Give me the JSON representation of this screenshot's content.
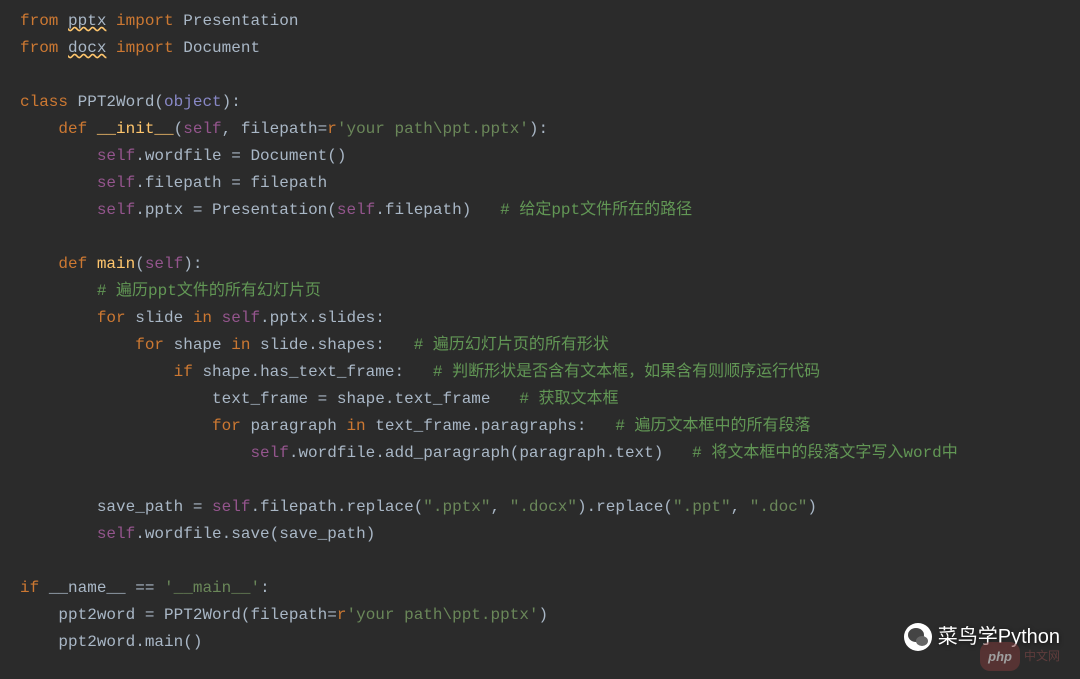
{
  "code_lines": [
    {
      "raw": "from pptx import Presentation",
      "tokens": [
        [
          "kw",
          "from "
        ],
        [
          "warn",
          "pptx"
        ],
        [
          "kw",
          " import "
        ],
        [
          "ident",
          "Presentation"
        ]
      ]
    },
    {
      "raw": "from docx import Document",
      "tokens": [
        [
          "kw",
          "from "
        ],
        [
          "warn",
          "docx"
        ],
        [
          "kw",
          " import "
        ],
        [
          "ident",
          "Document"
        ]
      ]
    },
    {
      "raw": ""
    },
    {
      "raw": "class PPT2Word(object):",
      "tokens": [
        [
          "kw",
          "class "
        ],
        [
          "ident",
          "PPT2Word"
        ],
        [
          "par",
          "("
        ],
        [
          "builtin",
          "object"
        ],
        [
          "par",
          ")"
        ],
        [
          "op",
          ":"
        ]
      ]
    },
    {
      "raw": "    def __init__(self, filepath=r'your path\\ppt.pptx'):",
      "tokens": [
        [
          "ident",
          "    "
        ],
        [
          "kw",
          "def "
        ],
        [
          "fn",
          "__init__"
        ],
        [
          "par",
          "("
        ],
        [
          "selfc",
          "self"
        ],
        [
          "op",
          ", "
        ],
        [
          "ident",
          "filepath"
        ],
        [
          "op",
          "="
        ],
        [
          "kw",
          "r"
        ],
        [
          "str",
          "'your path\\ppt.pptx'"
        ],
        [
          "par",
          ")"
        ],
        [
          "op",
          ":"
        ]
      ]
    },
    {
      "raw": "        self.wordfile = Document()",
      "tokens": [
        [
          "ident",
          "        "
        ],
        [
          "selfc",
          "self"
        ],
        [
          "op",
          "."
        ],
        [
          "ident",
          "wordfile "
        ],
        [
          "op",
          "= "
        ],
        [
          "ident",
          "Document"
        ],
        [
          "par",
          "()"
        ]
      ]
    },
    {
      "raw": "        self.filepath = filepath",
      "tokens": [
        [
          "ident",
          "        "
        ],
        [
          "selfc",
          "self"
        ],
        [
          "op",
          "."
        ],
        [
          "ident",
          "filepath "
        ],
        [
          "op",
          "= "
        ],
        [
          "ident",
          "filepath"
        ]
      ]
    },
    {
      "raw": "        self.pptx = Presentation(self.filepath)   # 给定ppt文件所在的路径",
      "tokens": [
        [
          "ident",
          "        "
        ],
        [
          "selfc",
          "self"
        ],
        [
          "op",
          "."
        ],
        [
          "ident",
          "pptx "
        ],
        [
          "op",
          "= "
        ],
        [
          "ident",
          "Presentation"
        ],
        [
          "par",
          "("
        ],
        [
          "selfc",
          "self"
        ],
        [
          "op",
          "."
        ],
        [
          "ident",
          "filepath"
        ],
        [
          "par",
          ")"
        ],
        [
          "ident",
          "   "
        ],
        [
          "cmtg",
          "# 给定ppt文件所在的路径"
        ]
      ]
    },
    {
      "raw": ""
    },
    {
      "raw": "    def main(self):",
      "tokens": [
        [
          "ident",
          "    "
        ],
        [
          "kw",
          "def "
        ],
        [
          "fn",
          "main"
        ],
        [
          "par",
          "("
        ],
        [
          "selfc",
          "self"
        ],
        [
          "par",
          ")"
        ],
        [
          "op",
          ":"
        ]
      ]
    },
    {
      "raw": "        # 遍历ppt文件的所有幻灯片页",
      "tokens": [
        [
          "ident",
          "        "
        ],
        [
          "cmtg",
          "# 遍历ppt文件的所有幻灯片页"
        ]
      ]
    },
    {
      "raw": "        for slide in self.pptx.slides:",
      "tokens": [
        [
          "ident",
          "        "
        ],
        [
          "kw",
          "for "
        ],
        [
          "ident",
          "slide "
        ],
        [
          "kw",
          "in "
        ],
        [
          "selfc",
          "self"
        ],
        [
          "op",
          "."
        ],
        [
          "ident",
          "pptx"
        ],
        [
          "op",
          "."
        ],
        [
          "ident",
          "slides"
        ],
        [
          "op",
          ":"
        ]
      ]
    },
    {
      "raw": "            for shape in slide.shapes:   # 遍历幻灯片页的所有形状",
      "tokens": [
        [
          "ident",
          "            "
        ],
        [
          "kw",
          "for "
        ],
        [
          "ident",
          "shape "
        ],
        [
          "kw",
          "in "
        ],
        [
          "ident",
          "slide"
        ],
        [
          "op",
          "."
        ],
        [
          "ident",
          "shapes"
        ],
        [
          "op",
          ":   "
        ],
        [
          "cmtg",
          "# 遍历幻灯片页的所有形状"
        ]
      ]
    },
    {
      "raw": "                if shape.has_text_frame:   # 判断形状是否含有文本框，如果含有则顺序运行代码",
      "tokens": [
        [
          "ident",
          "                "
        ],
        [
          "kw",
          "if "
        ],
        [
          "ident",
          "shape"
        ],
        [
          "op",
          "."
        ],
        [
          "ident",
          "has_text_frame"
        ],
        [
          "op",
          ":   "
        ],
        [
          "cmtg",
          "# 判断形状是否含有文本框，如果含有则顺序运行代码"
        ]
      ]
    },
    {
      "raw": "                    text_frame = shape.text_frame   # 获取文本框",
      "tokens": [
        [
          "ident",
          "                    "
        ],
        [
          "ident",
          "text_frame "
        ],
        [
          "op",
          "= "
        ],
        [
          "ident",
          "shape"
        ],
        [
          "op",
          "."
        ],
        [
          "ident",
          "text_frame   "
        ],
        [
          "cmtg",
          "# 获取文本框"
        ]
      ]
    },
    {
      "raw": "                    for paragraph in text_frame.paragraphs:   # 遍历文本框中的所有段落",
      "tokens": [
        [
          "ident",
          "                    "
        ],
        [
          "kw",
          "for "
        ],
        [
          "ident",
          "paragraph "
        ],
        [
          "kw",
          "in "
        ],
        [
          "ident",
          "text_frame"
        ],
        [
          "op",
          "."
        ],
        [
          "ident",
          "paragraphs"
        ],
        [
          "op",
          ":   "
        ],
        [
          "cmtg",
          "# 遍历文本框中的所有段落"
        ]
      ]
    },
    {
      "raw": "                        self.wordfile.add_paragraph(paragraph.text)   # 将文本框中的段落文字写入word中",
      "tokens": [
        [
          "ident",
          "                        "
        ],
        [
          "selfc",
          "self"
        ],
        [
          "op",
          "."
        ],
        [
          "ident",
          "wordfile"
        ],
        [
          "op",
          "."
        ],
        [
          "ident",
          "add_paragraph"
        ],
        [
          "par",
          "("
        ],
        [
          "ident",
          "paragraph"
        ],
        [
          "op",
          "."
        ],
        [
          "ident",
          "text"
        ],
        [
          "par",
          ")"
        ],
        [
          "ident",
          "   "
        ],
        [
          "cmtg",
          "# 将文本框中的段落文字写入word中"
        ]
      ]
    },
    {
      "raw": ""
    },
    {
      "raw": "        save_path = self.filepath.replace(\".pptx\", \".docx\").replace(\".ppt\", \".doc\")",
      "tokens": [
        [
          "ident",
          "        "
        ],
        [
          "ident",
          "save_path "
        ],
        [
          "op",
          "= "
        ],
        [
          "selfc",
          "self"
        ],
        [
          "op",
          "."
        ],
        [
          "ident",
          "filepath"
        ],
        [
          "op",
          "."
        ],
        [
          "ident",
          "replace"
        ],
        [
          "par",
          "("
        ],
        [
          "str",
          "\".pptx\""
        ],
        [
          "op",
          ", "
        ],
        [
          "str",
          "\".docx\""
        ],
        [
          "par",
          ")"
        ],
        [
          "op",
          "."
        ],
        [
          "ident",
          "replace"
        ],
        [
          "par",
          "("
        ],
        [
          "str",
          "\".ppt\""
        ],
        [
          "op",
          ", "
        ],
        [
          "str",
          "\".doc\""
        ],
        [
          "par",
          ")"
        ]
      ]
    },
    {
      "raw": "        self.wordfile.save(save_path)",
      "tokens": [
        [
          "ident",
          "        "
        ],
        [
          "selfc",
          "self"
        ],
        [
          "op",
          "."
        ],
        [
          "ident",
          "wordfile"
        ],
        [
          "op",
          "."
        ],
        [
          "ident",
          "save"
        ],
        [
          "par",
          "("
        ],
        [
          "ident",
          "save_path"
        ],
        [
          "par",
          ")"
        ]
      ]
    },
    {
      "raw": ""
    },
    {
      "raw": "if __name__ == '__main__':",
      "tokens": [
        [
          "kw",
          "if "
        ],
        [
          "ident",
          "__name__ "
        ],
        [
          "op",
          "== "
        ],
        [
          "str",
          "'__main__'"
        ],
        [
          "op",
          ":"
        ]
      ]
    },
    {
      "raw": "    ppt2word = PPT2Word(filepath=r'your path\\ppt.pptx')",
      "tokens": [
        [
          "ident",
          "    "
        ],
        [
          "ident",
          "ppt2word "
        ],
        [
          "op",
          "= "
        ],
        [
          "ident",
          "PPT2Word"
        ],
        [
          "par",
          "("
        ],
        [
          "ident",
          "filepath"
        ],
        [
          "op",
          "="
        ],
        [
          "kw",
          "r"
        ],
        [
          "str",
          "'your path\\ppt.pptx'"
        ],
        [
          "par",
          ")"
        ]
      ]
    },
    {
      "raw": "    ppt2word.main()",
      "tokens": [
        [
          "ident",
          "    "
        ],
        [
          "ident",
          "ppt2word"
        ],
        [
          "op",
          "."
        ],
        [
          "ident",
          "main"
        ],
        [
          "par",
          "()"
        ]
      ]
    }
  ],
  "watermark": {
    "text": "菜鸟学Python"
  },
  "php_badge": {
    "pill": "php",
    "text": "中文网"
  }
}
